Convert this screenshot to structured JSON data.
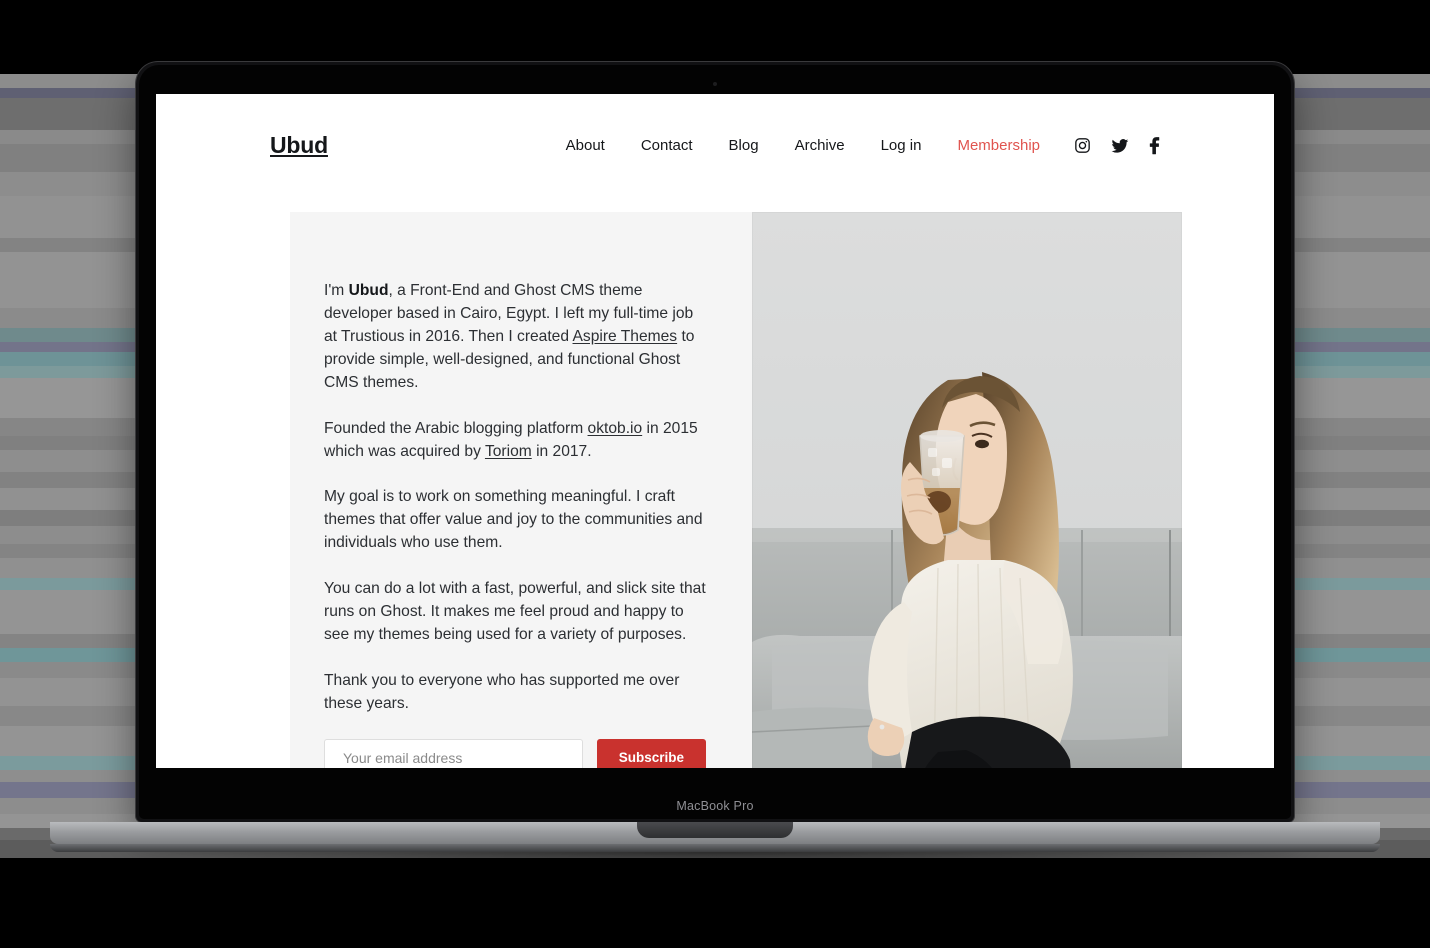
{
  "device": {
    "model_label": "MacBook Pro"
  },
  "site": {
    "brand": "Ubud",
    "nav": [
      {
        "label": "About",
        "accent": false
      },
      {
        "label": "Contact",
        "accent": false
      },
      {
        "label": "Blog",
        "accent": false
      },
      {
        "label": "Archive",
        "accent": false
      },
      {
        "label": "Log in",
        "accent": false
      },
      {
        "label": "Membership",
        "accent": true
      }
    ],
    "social": [
      {
        "name": "instagram-icon"
      },
      {
        "name": "twitter-icon"
      },
      {
        "name": "facebook-icon"
      }
    ],
    "hero": {
      "paragraphs": {
        "p1_a": "I'm ",
        "p1_bold": "Ubud",
        "p1_b": ", a Front-End and Ghost CMS theme developer based in Cairo, Egypt. I left my full-time job at Trustious in 2016. Then I created ",
        "p1_link": "Aspire Themes",
        "p1_c": " to provide simple, well-designed, and functional Ghost CMS themes.",
        "p2_a": "Founded the Arabic blogging platform ",
        "p2_link1": "oktob.io",
        "p2_b": " in 2015 which was acquired by ",
        "p2_link2": "Toriom",
        "p2_c": " in 2017.",
        "p3": "My goal is to work on something meaningful. I craft themes that offer value and joy to the communities and individuals who use them.",
        "p4": "You can do a lot with a fast, powerful, and slick site that runs on Ghost. It makes me feel proud and happy to see my themes being used for a variety of purposes.",
        "p5": "Thank you to everyone who has supported me over these years."
      },
      "subscribe": {
        "email_placeholder": "Your email address",
        "email_value": "",
        "button_label": "Subscribe"
      },
      "photo_alt": "Woman in cream sweater and black jeans sitting on a light gray couch drinking from a glass"
    }
  },
  "colors": {
    "accent_link": "#e0544f",
    "button_red": "#c9322e",
    "text": "#15171a",
    "panel_bg": "#f5f5f5",
    "page_bg": "#ffffff"
  }
}
